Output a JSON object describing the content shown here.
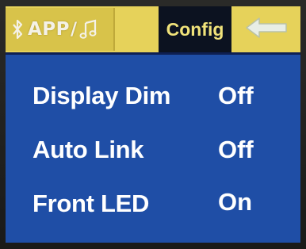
{
  "header": {
    "app_label": "APP",
    "separator": "/",
    "config_label": "Config",
    "icons": {
      "bluetooth": "bluetooth-icon",
      "music": "music-note-icon",
      "back": "back-arrow-icon"
    }
  },
  "settings": [
    {
      "label": "Display Dim",
      "value": "Off"
    },
    {
      "label": "Auto Link",
      "value": "Off"
    },
    {
      "label": "Front LED",
      "value": "On"
    }
  ],
  "colors": {
    "screen_background": "#1f4ea6",
    "tab_background": "#e6d25a",
    "active_tab_background": "#0c1220",
    "active_tab_text": "#f0e27a",
    "text": "#ffffff"
  }
}
